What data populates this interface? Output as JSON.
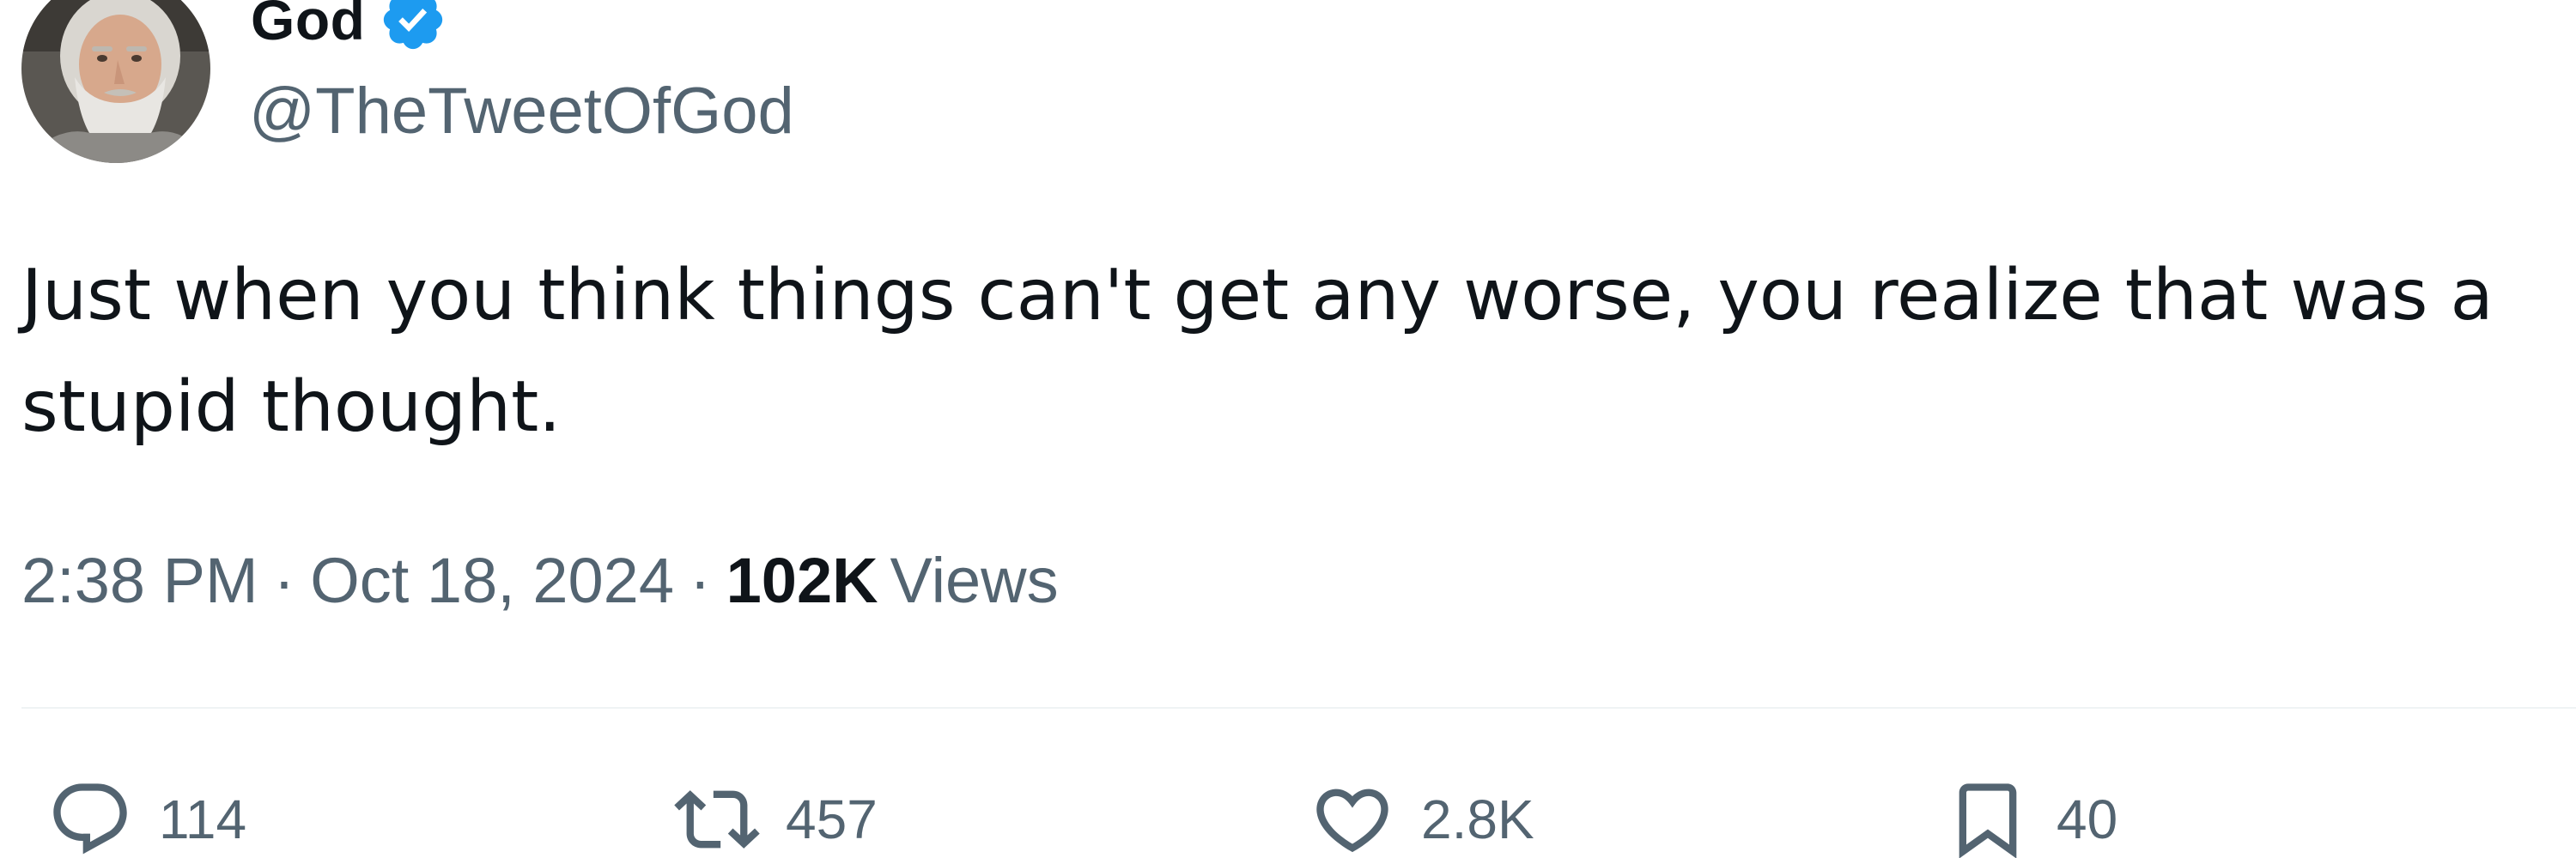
{
  "user": {
    "display_name": "God",
    "handle": "@TheTweetOfGod",
    "verified": true,
    "avatar_icon": "avatar-bearded-man"
  },
  "tweet": {
    "text": "Just when you think things can't get any worse, you realize that was a stupid thought.",
    "time": "2:38 PM",
    "separator": "·",
    "date": "Oct 18, 2024",
    "views_count": "102K",
    "views_label": "Views"
  },
  "actions": {
    "reply": {
      "icon": "reply-icon",
      "count": "114"
    },
    "retweet": {
      "icon": "retweet-icon",
      "count": "457"
    },
    "like": {
      "icon": "heart-icon",
      "count": "2.8K"
    },
    "bookmark": {
      "icon": "bookmark-icon",
      "count": "40"
    }
  },
  "colors": {
    "text_primary": "#0f1419",
    "text_secondary": "#536471",
    "verified_blue": "#1d9bf0",
    "divider": "#eff3f4"
  }
}
